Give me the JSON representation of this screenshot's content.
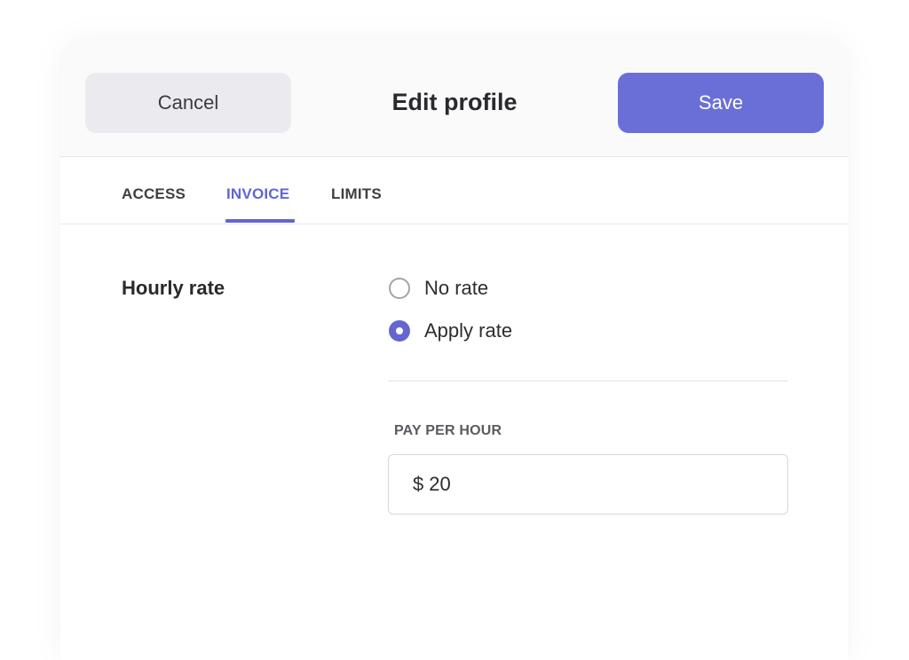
{
  "header": {
    "cancel_label": "Cancel",
    "title": "Edit profile",
    "save_label": "Save"
  },
  "tabs": [
    {
      "label": "ACCESS",
      "active": false
    },
    {
      "label": "INVOICE",
      "active": true
    },
    {
      "label": "LIMITS",
      "active": false
    }
  ],
  "hourly_rate": {
    "label": "Hourly rate",
    "options": [
      {
        "label": "No rate",
        "selected": false
      },
      {
        "label": "Apply rate",
        "selected": true
      }
    ]
  },
  "pay_per_hour": {
    "label": "PAY PER HOUR",
    "currency": "$",
    "value": "20"
  },
  "colors": {
    "accent": "#6366d1",
    "save_button": "#6a6fd8",
    "cancel_button": "#ebebef"
  }
}
